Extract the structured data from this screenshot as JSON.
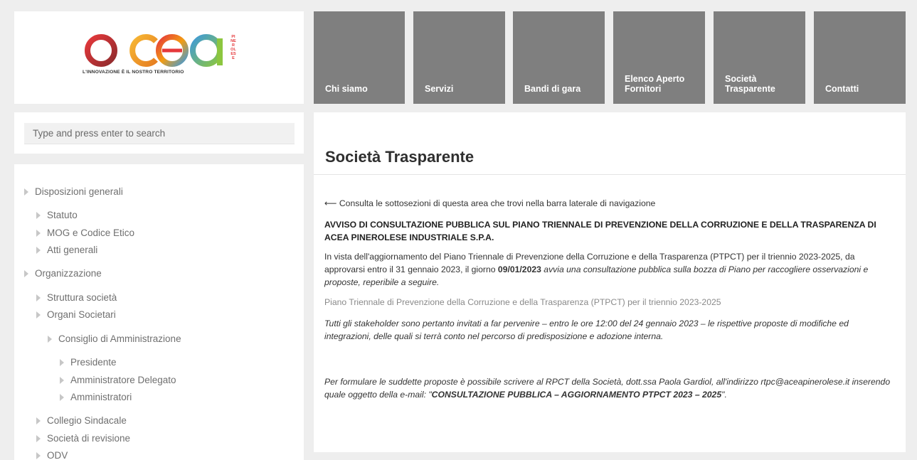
{
  "logo": {
    "wordmark": "acea",
    "tagline": "L'INNOVAZIONE È IL NOSTRO TERRITORIO",
    "side_text": "PINEROLESE"
  },
  "nav": [
    {
      "label": "Chi siamo"
    },
    {
      "label": "Servizi"
    },
    {
      "label": "Bandi di gara"
    },
    {
      "label": "Elenco Aperto Fornitori"
    },
    {
      "label": "Società Trasparente"
    },
    {
      "label": "Contatti"
    }
  ],
  "search": {
    "placeholder": "Type and press enter to search"
  },
  "sidebar": {
    "items": [
      {
        "label": "Disposizioni generali"
      },
      {
        "label": "Statuto"
      },
      {
        "label": "MOG e Codice Etico"
      },
      {
        "label": "Atti generali"
      },
      {
        "label": "Organizzazione"
      },
      {
        "label": "Struttura società"
      },
      {
        "label": "Organi Societari"
      },
      {
        "label": "Consiglio di Amministrazione"
      },
      {
        "label": "Presidente"
      },
      {
        "label": "Amministratore Delegato"
      },
      {
        "label": "Amministratori"
      },
      {
        "label": "Collegio Sindacale"
      },
      {
        "label": "Società di revisione"
      },
      {
        "label": "ODV"
      }
    ]
  },
  "content": {
    "title": "Società Trasparente",
    "intro": "⟵ Consulta le sottosezioni di questa area che trovi nella barra laterale di navigazione",
    "avviso": "AVVISO DI CONSULTAZIONE PUBBLICA SUL PIANO TRIENNALE DI PREVENZIONE DELLA CORRUZIONE E DELLA TRASPARENZA DI ACEA PINEROLESE INDUSTRIALE S.P.A.",
    "p_vista_a": "In vista dell'aggiornamento del Piano Triennale di Prevenzione della Corruzione e della Trasparenza (PTPCT) per il triennio 2023-2025, da approvarsi entro il 31 gennaio 2023, il giorno ",
    "p_vista_date": "09/01/2023",
    "p_vista_b": " avvia una consultazione pubblica sulla bozza di Piano per raccogliere osservazioni e proposte, reperibile a seguire.",
    "link_piano": "Piano Triennale di Prevenzione della Corruzione e della Trasparenza (PTPCT) per il triennio 2023-2025",
    "p_stakeholder": "Tutti gli stakeholder sono pertanto invitati a far pervenire – entro le ore 12:00 del 24 gennaio 2023 – le rispettive proposte di modifiche ed integrazioni, delle quali si terrà conto nel percorso di predisposizione e adozione interna.",
    "p_formulare_a": "Per formulare le suddette proposte è possibile scrivere al RPCT della Società, dott.ssa Paola Gardiol, all'indirizzo rtpc@aceapinerolese.it inserendo quale oggetto della e-mail:  \"",
    "p_formulare_subject": "CONSULTAZIONE PUBBLICA –  AGGIORNAMENTO PTPCT 2023 – 2025",
    "p_formulare_b": "\"."
  },
  "colors": {
    "nav_bg": "#7f7f7f",
    "page_bg": "#eeeeee",
    "logo_ring_colors": [
      "#e5383b",
      "#f39c12",
      "#3f9ad8",
      "#8cc63f"
    ]
  }
}
